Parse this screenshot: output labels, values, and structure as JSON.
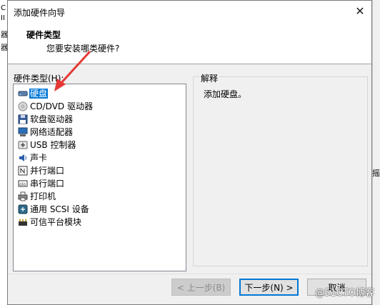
{
  "background": {
    "left_chars": [
      "C",
      "II",
      "器",
      "器"
    ],
    "right_char": "摇"
  },
  "dialog": {
    "title": "添加硬件向导",
    "close_icon": "✕",
    "header_title": "硬件类型",
    "header_subtitle": "您要安装哪类硬件?",
    "list_label": "硬件类型(H):",
    "items": [
      {
        "label": "硬盘",
        "icon": "hard-disk-icon",
        "selected": true
      },
      {
        "label": "CD/DVD 驱动器",
        "icon": "cd-dvd-icon",
        "selected": false
      },
      {
        "label": "软盘驱动器",
        "icon": "floppy-icon",
        "selected": false
      },
      {
        "label": "网络适配器",
        "icon": "network-icon",
        "selected": false
      },
      {
        "label": "USB 控制器",
        "icon": "usb-icon",
        "selected": false
      },
      {
        "label": "声卡",
        "icon": "sound-icon",
        "selected": false
      },
      {
        "label": "并行端口",
        "icon": "parallel-port-icon",
        "selected": false
      },
      {
        "label": "串行端口",
        "icon": "serial-port-icon",
        "selected": false
      },
      {
        "label": "打印机",
        "icon": "printer-icon",
        "selected": false
      },
      {
        "label": "通用 SCSI 设备",
        "icon": "scsi-icon",
        "selected": false
      },
      {
        "label": "可信平台模块",
        "icon": "tpm-icon",
        "selected": false
      }
    ],
    "explain_title": "解释",
    "explain_text": "添加硬盘。",
    "buttons": {
      "back": "< 上一步(B)",
      "next": "下一步(N) >",
      "cancel": "取消"
    }
  },
  "watermark": "@51CTO博客",
  "colors": {
    "selection": "#0078d7",
    "arrow": "#e53935"
  }
}
